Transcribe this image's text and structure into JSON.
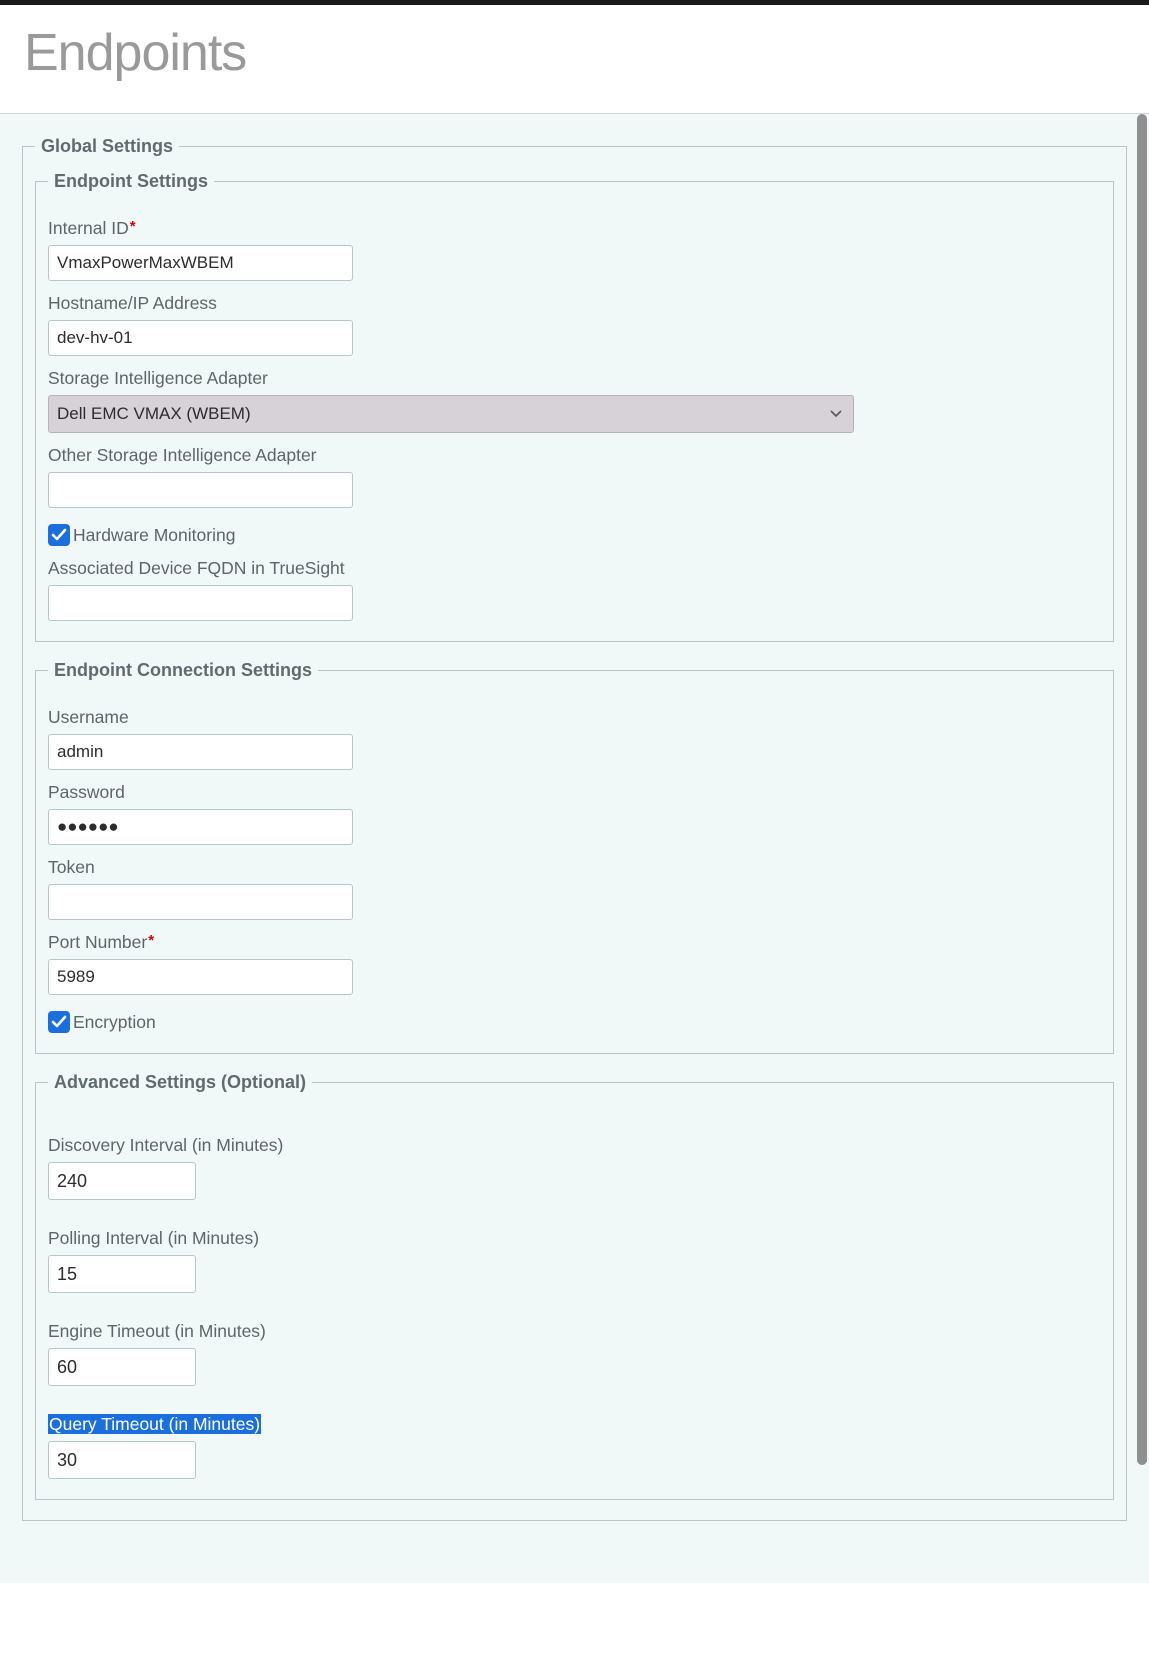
{
  "header": {
    "title": "Endpoints"
  },
  "global": {
    "legend": "Global Settings",
    "endpoint": {
      "legend": "Endpoint Settings",
      "internalId": {
        "label": "Internal ID",
        "value": "VmaxPowerMaxWBEM"
      },
      "hostname": {
        "label": "Hostname/IP Address",
        "value": "dev-hv-01"
      },
      "adapter": {
        "label": "Storage Intelligence Adapter",
        "value": "Dell EMC VMAX (WBEM)"
      },
      "otherAdapter": {
        "label": "Other Storage Intelligence Adapter",
        "value": ""
      },
      "hardwareMonitoring": {
        "label": "Hardware Monitoring",
        "checked": true
      },
      "associatedDevice": {
        "label": "Associated Device FQDN in TrueSight",
        "value": ""
      }
    },
    "connection": {
      "legend": "Endpoint Connection Settings",
      "username": {
        "label": "Username",
        "value": "admin"
      },
      "password": {
        "label": "Password",
        "value": "●●●●●●"
      },
      "token": {
        "label": "Token",
        "value": ""
      },
      "port": {
        "label": "Port Number",
        "value": "5989"
      },
      "encryption": {
        "label": "Encryption",
        "checked": true
      }
    },
    "advanced": {
      "legend": "Advanced Settings (Optional)",
      "discoveryInterval": {
        "label": "Discovery Interval (in Minutes)",
        "value": "240"
      },
      "pollingInterval": {
        "label": "Polling Interval (in Minutes)",
        "value": "15"
      },
      "engineTimeout": {
        "label": "Engine Timeout (in Minutes)",
        "value": "60"
      },
      "queryTimeout": {
        "label": "Query Timeout (in Minutes)",
        "value": "30"
      }
    }
  }
}
